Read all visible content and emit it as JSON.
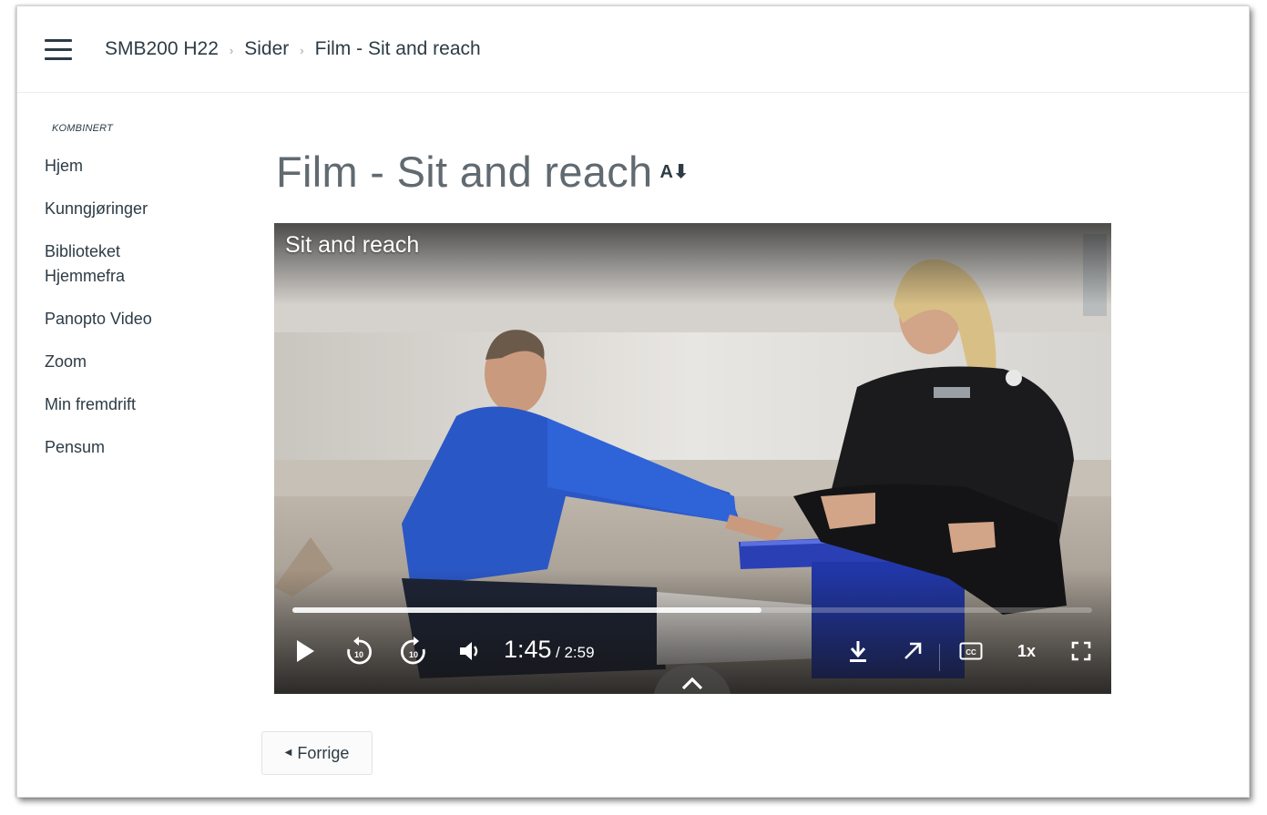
{
  "header": {
    "breadcrumbs": [
      "SMB200 H22",
      "Sider",
      "Film - Sit and reach"
    ],
    "menu_icon": "hamburger-icon"
  },
  "sidebar": {
    "caption": "KOMBINERT",
    "items": [
      {
        "label": "Hjem"
      },
      {
        "label": "Kunngjøringer"
      },
      {
        "label": "Biblioteket Hjemmefra"
      },
      {
        "label": "Panopto Video"
      },
      {
        "label": "Zoom"
      },
      {
        "label": "Min fremdrift"
      },
      {
        "label": "Pensum"
      }
    ]
  },
  "main": {
    "title": "Film - Sit and reach",
    "a11y_icon_label": "A⬇"
  },
  "video": {
    "title": "Sit and reach",
    "current_time": "1:45",
    "duration": "/ 2:59",
    "progress_fraction": 0.586,
    "speed_label": "1x",
    "controls": [
      "play-icon",
      "rewind-10-icon",
      "forward-10-icon",
      "volume-icon",
      "download-icon",
      "popout-icon",
      "captions-icon",
      "speed",
      "fullscreen-icon"
    ]
  },
  "footer_nav": {
    "prev_label": "Forrige"
  }
}
